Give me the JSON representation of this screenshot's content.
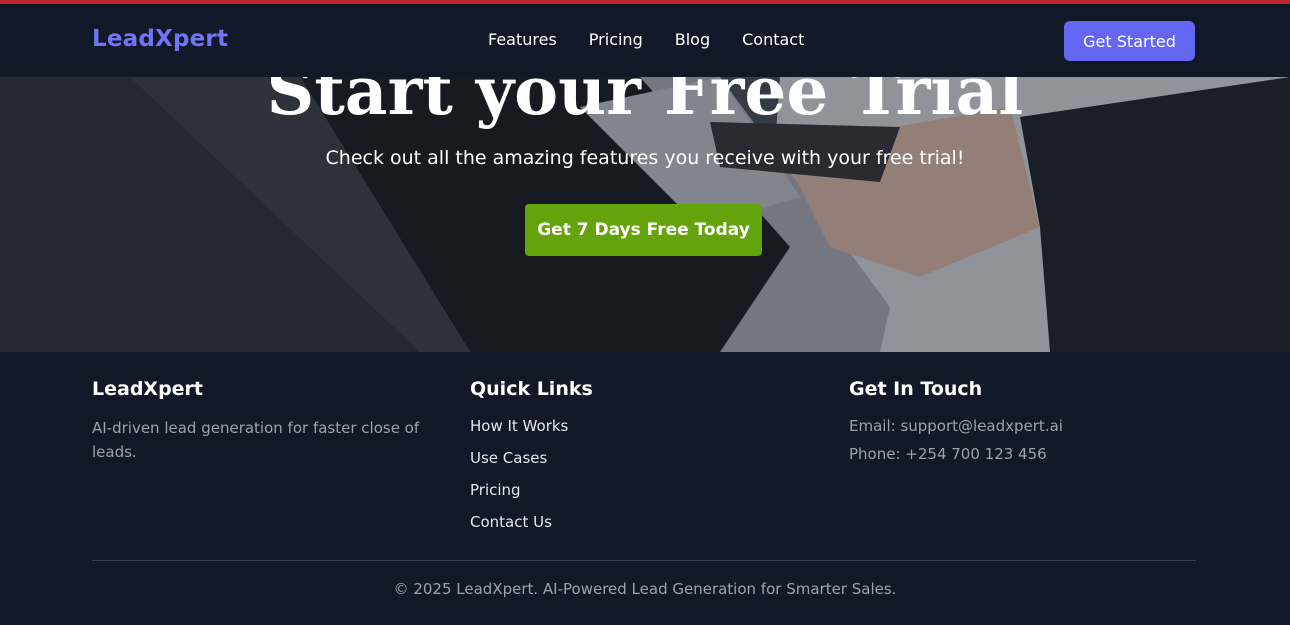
{
  "nav": {
    "logo": "LeadXpert",
    "links": [
      "Features",
      "Pricing",
      "Blog",
      "Contact"
    ],
    "cta": "Get Started"
  },
  "hero": {
    "title": "Start your Free Trial",
    "subtitle": "Check out all the amazing features you receive with your free trial!",
    "cta": "Get 7 Days Free Today"
  },
  "footer": {
    "brand": {
      "title": "LeadXpert",
      "description": "AI-driven lead generation for faster close of leads."
    },
    "quick_links": {
      "title": "Quick Links",
      "items": [
        "How It Works",
        "Use Cases",
        "Pricing",
        "Contact Us"
      ]
    },
    "contact": {
      "title": "Get In Touch",
      "email": "Email: support@leadxpert.ai",
      "phone": "Phone: +254 700 123 456"
    },
    "copyright": "© 2025 LeadXpert. AI-Powered Lead Generation for Smarter Sales."
  },
  "colors": {
    "accent": "#6366f1",
    "logo": "#7075f5",
    "cta_green": "#65a30d",
    "top_line": "#c0282d",
    "background": "#111827"
  }
}
